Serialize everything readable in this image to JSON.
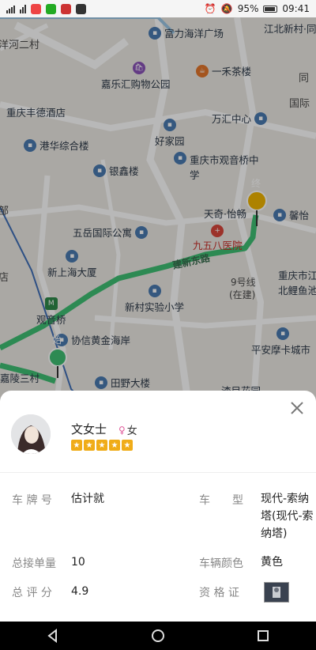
{
  "status_bar": {
    "battery": "95%",
    "time": "09:41"
  },
  "map": {
    "pois": [
      "富力海洋广场",
      "江北新村·同",
      "一禾茶楼",
      "嘉乐汇购物公园",
      "重庆丰德酒店",
      "万汇中心",
      "好家园",
      "港华综合楼",
      "银鑫楼",
      "重庆市观音桥中学",
      "天奇·怡畅",
      "馨怡",
      "五岳国际公寓",
      "九五八医院",
      "新上海大厦",
      "重庆市江北鲤鱼池",
      "新村实验小学",
      "观音桥",
      "协信黄金海岸",
      "平安摩卡城市",
      "田野大楼",
      "嘉陵三村",
      "渣目花园",
      "洋河二村",
      "同",
      "国际",
      "店"
    ],
    "roads": [
      "建新东路"
    ],
    "transit": [
      "9号线",
      "(在建)"
    ],
    "start_marker": "始",
    "end_marker": "终"
  },
  "driver": {
    "name": "文女士",
    "gender": "女",
    "rating_stars": 5
  },
  "details": {
    "plate_label": "车 牌 号",
    "plate_value": "估计就",
    "model_label": "车　　型",
    "model_value": "现代-索纳塔(现代-索纳塔)",
    "orders_label": "总接单量",
    "orders_value": "10",
    "color_label": "车辆颜色",
    "color_value": "黄色",
    "score_label": "总 评 分",
    "score_value": "4.9",
    "cert_label": "资 格 证"
  },
  "colors": {
    "route": "#3fbf74",
    "star": "#f0ac18",
    "marker_start": "#3fbf74",
    "marker_end": "#f0b400"
  }
}
